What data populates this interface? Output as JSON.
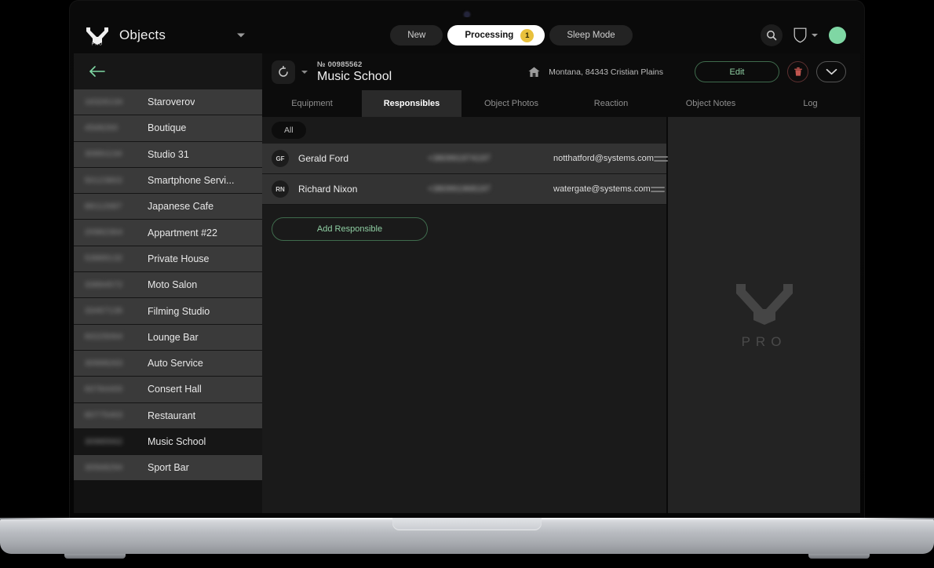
{
  "app": {
    "brand_title": "Objects",
    "logo_text": "PRO"
  },
  "topbar": {
    "segments": [
      {
        "label": "New",
        "active": false,
        "badge": ""
      },
      {
        "label": "Processing",
        "active": true,
        "badge": "1"
      },
      {
        "label": "Sleep Mode",
        "active": false,
        "badge": ""
      }
    ],
    "search_icon": "search-icon",
    "shield_icon": "shield-icon",
    "avatar_color": "#7fd7a4"
  },
  "sidebar": {
    "back_icon": "back-arrow-icon",
    "items": [
      {
        "id": "16326134",
        "name": "Staroverov",
        "selected": false
      },
      {
        "id": "4568260",
        "name": "Boutique",
        "selected": false
      },
      {
        "id": "30891134",
        "name": "Studio 31",
        "selected": false
      },
      {
        "id": "50123802",
        "name": "Smartphone Servi...",
        "selected": false
      },
      {
        "id": "88112687",
        "name": "Japanese Cafe",
        "selected": false
      },
      {
        "id": "20982364",
        "name": "Appartment #22",
        "selected": false
      },
      {
        "id": "53889132",
        "name": "Private House",
        "selected": false
      },
      {
        "id": "33894572",
        "name": "Moto Salon",
        "selected": false
      },
      {
        "id": "33467136",
        "name": "Filming Studio",
        "selected": false
      },
      {
        "id": "60225064",
        "name": "Lounge Bar",
        "selected": false
      },
      {
        "id": "30998263",
        "name": "Auto Service",
        "selected": false
      },
      {
        "id": "60784400",
        "name": "Consert Hall",
        "selected": false
      },
      {
        "id": "80775463",
        "name": "Restaurant",
        "selected": false
      },
      {
        "id": "30985562",
        "name": "Music School",
        "selected": true
      },
      {
        "id": "30568294",
        "name": "Sport Bar",
        "selected": false
      }
    ]
  },
  "object_header": {
    "refresh_icon": "refresh-icon",
    "number": "№ 00985562",
    "title": "Music School",
    "home_icon": "home-icon",
    "address": "Montana, 84343 Cristian Plains",
    "edit_label": "Edit",
    "delete_icon": "trash-icon",
    "expand_icon": "chevron-down-icon",
    "accent_green": "#8fcfa3",
    "accent_red": "#c0554f"
  },
  "tabs": [
    {
      "label": "Equipment",
      "active": false
    },
    {
      "label": "Responsibles",
      "active": true
    },
    {
      "label": "Object Photos",
      "active": false
    },
    {
      "label": "Reaction",
      "active": false
    },
    {
      "label": "Object Notes",
      "active": false
    },
    {
      "label": "Log",
      "active": false
    }
  ],
  "responsibles_pane": {
    "filter_chip": "All",
    "rows": [
      {
        "initials": "GF",
        "name": "Gerald Ford",
        "phone": "+380991974197",
        "email": "notthatford@systems.com"
      },
      {
        "initials": "RN",
        "name": "Richard Nixon",
        "phone": "+380991968197",
        "email": "watergate@systems.com"
      }
    ],
    "add_label": "Add Responsible"
  },
  "right_pane": {
    "watermark_text": "PRO"
  }
}
